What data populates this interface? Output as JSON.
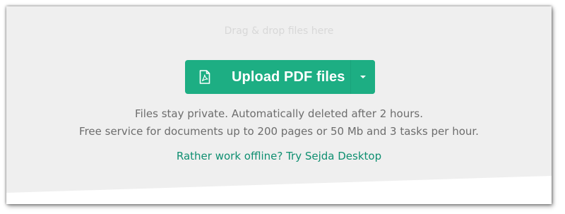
{
  "drop_hint": "Drag & drop files here",
  "upload": {
    "label": "Upload PDF files",
    "icon": "pdf-file-icon",
    "dropdown_icon": "chevron-down-icon"
  },
  "info": {
    "line1": "Files stay private. Automatically deleted after 2 hours.",
    "line2": "Free service for documents up to 200 pages or 50 Mb and 3 tasks per hour."
  },
  "offline_link": "Rather work offline? Try Sejda Desktop",
  "colors": {
    "accent": "#1dae83",
    "link": "#0f8f71",
    "background": "#efefef"
  }
}
